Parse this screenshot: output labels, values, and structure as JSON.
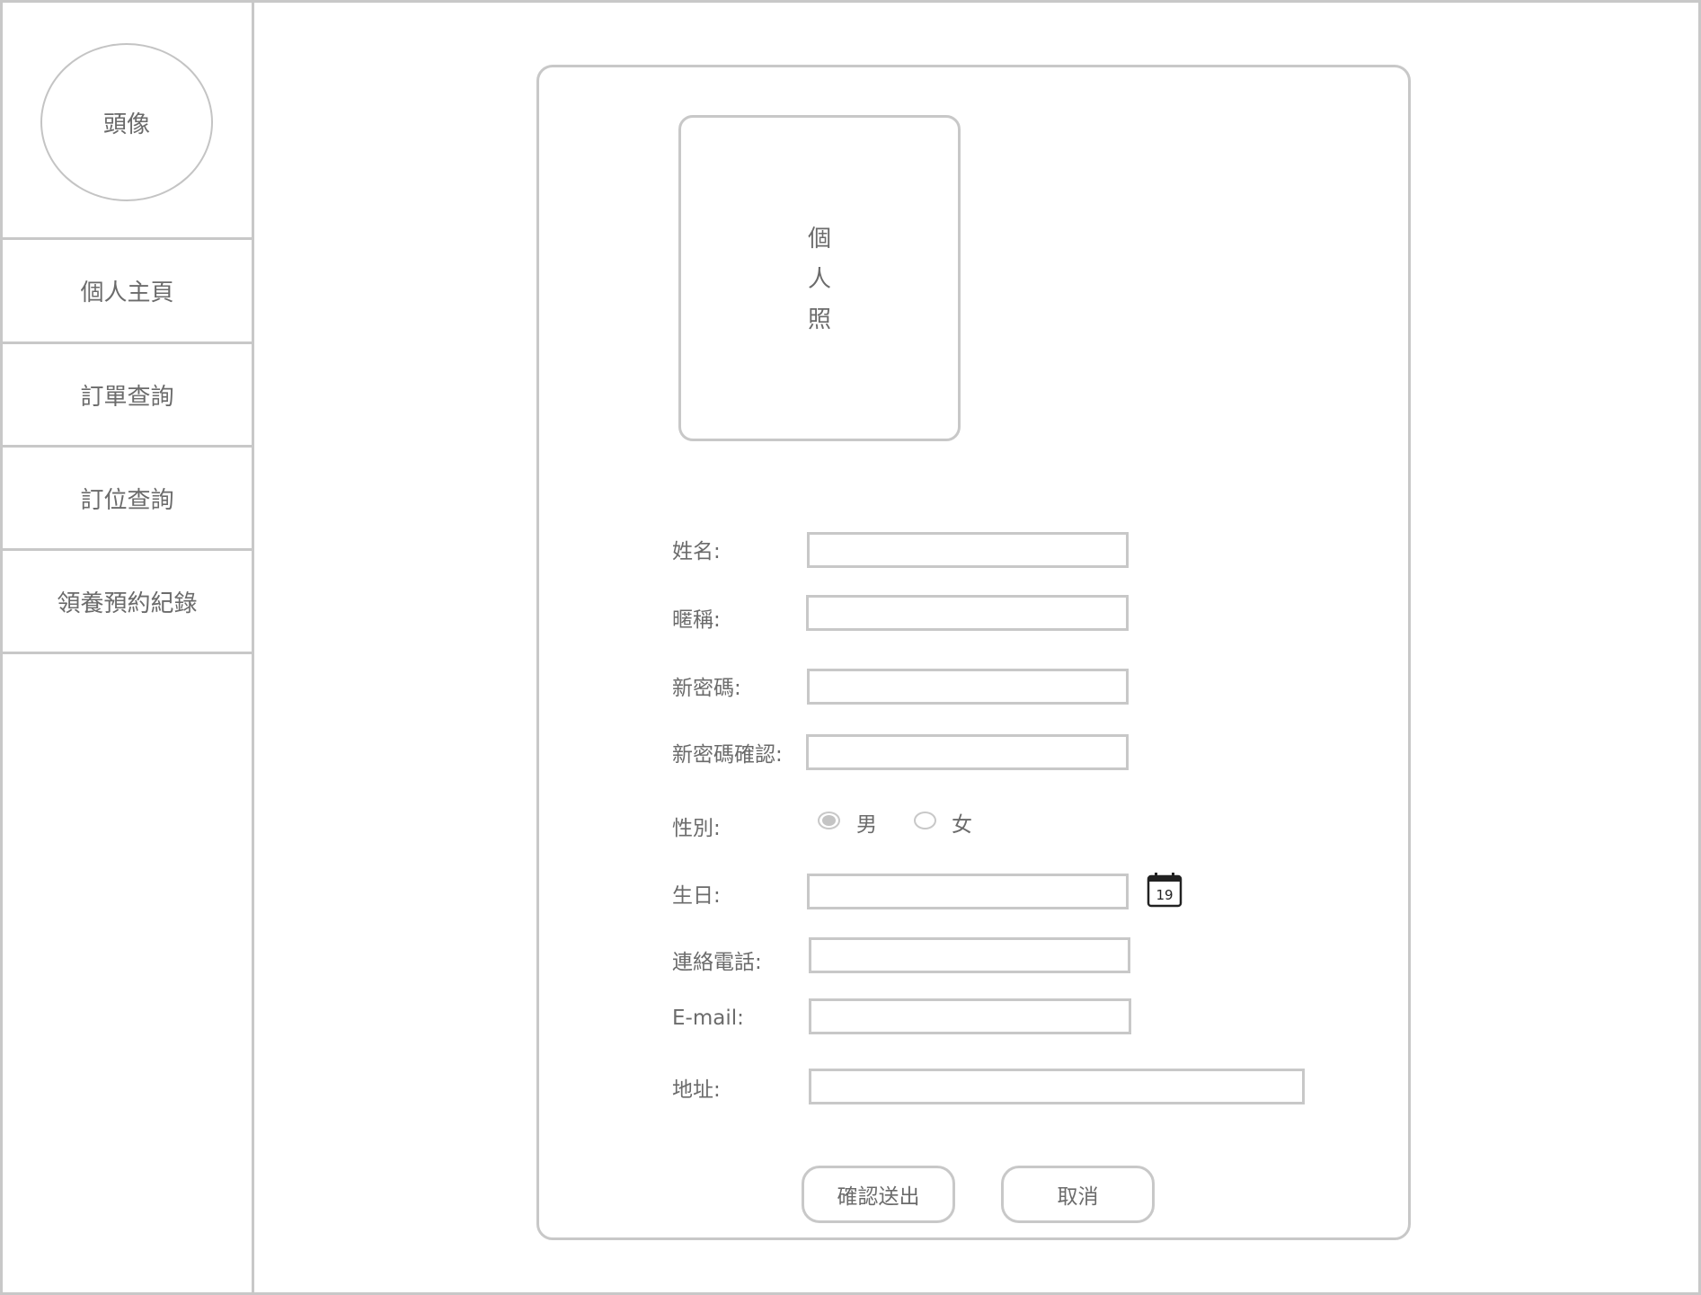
{
  "sidebar": {
    "avatar_label": "頭像",
    "items": [
      {
        "label": "個人主頁"
      },
      {
        "label": "訂單查詢"
      },
      {
        "label": "訂位查詢"
      },
      {
        "label": "領養預約紀錄"
      }
    ]
  },
  "profile": {
    "photo_label": "個人照"
  },
  "form": {
    "name_label": "姓名:",
    "nickname_label": "暱稱:",
    "new_password_label": "新密碼:",
    "confirm_password_label": "新密碼確認:",
    "gender_label": "性別:",
    "gender_options": [
      {
        "label": "男",
        "selected": true
      },
      {
        "label": "女",
        "selected": false
      }
    ],
    "birthday_label": "生日:",
    "calendar_icon": "calendar-icon",
    "calendar_day": "19",
    "phone_label": "連絡電話:",
    "email_label": "E-mail:",
    "address_label": "地址:",
    "name_value": "",
    "nickname_value": "",
    "new_password_value": "",
    "confirm_password_value": "",
    "birthday_value": "",
    "phone_value": "",
    "email_value": "",
    "address_value": ""
  },
  "actions": {
    "submit_label": "確認送出",
    "cancel_label": "取消"
  },
  "colors": {
    "border": "#c8c8c8",
    "text": "#6b6b6b"
  }
}
